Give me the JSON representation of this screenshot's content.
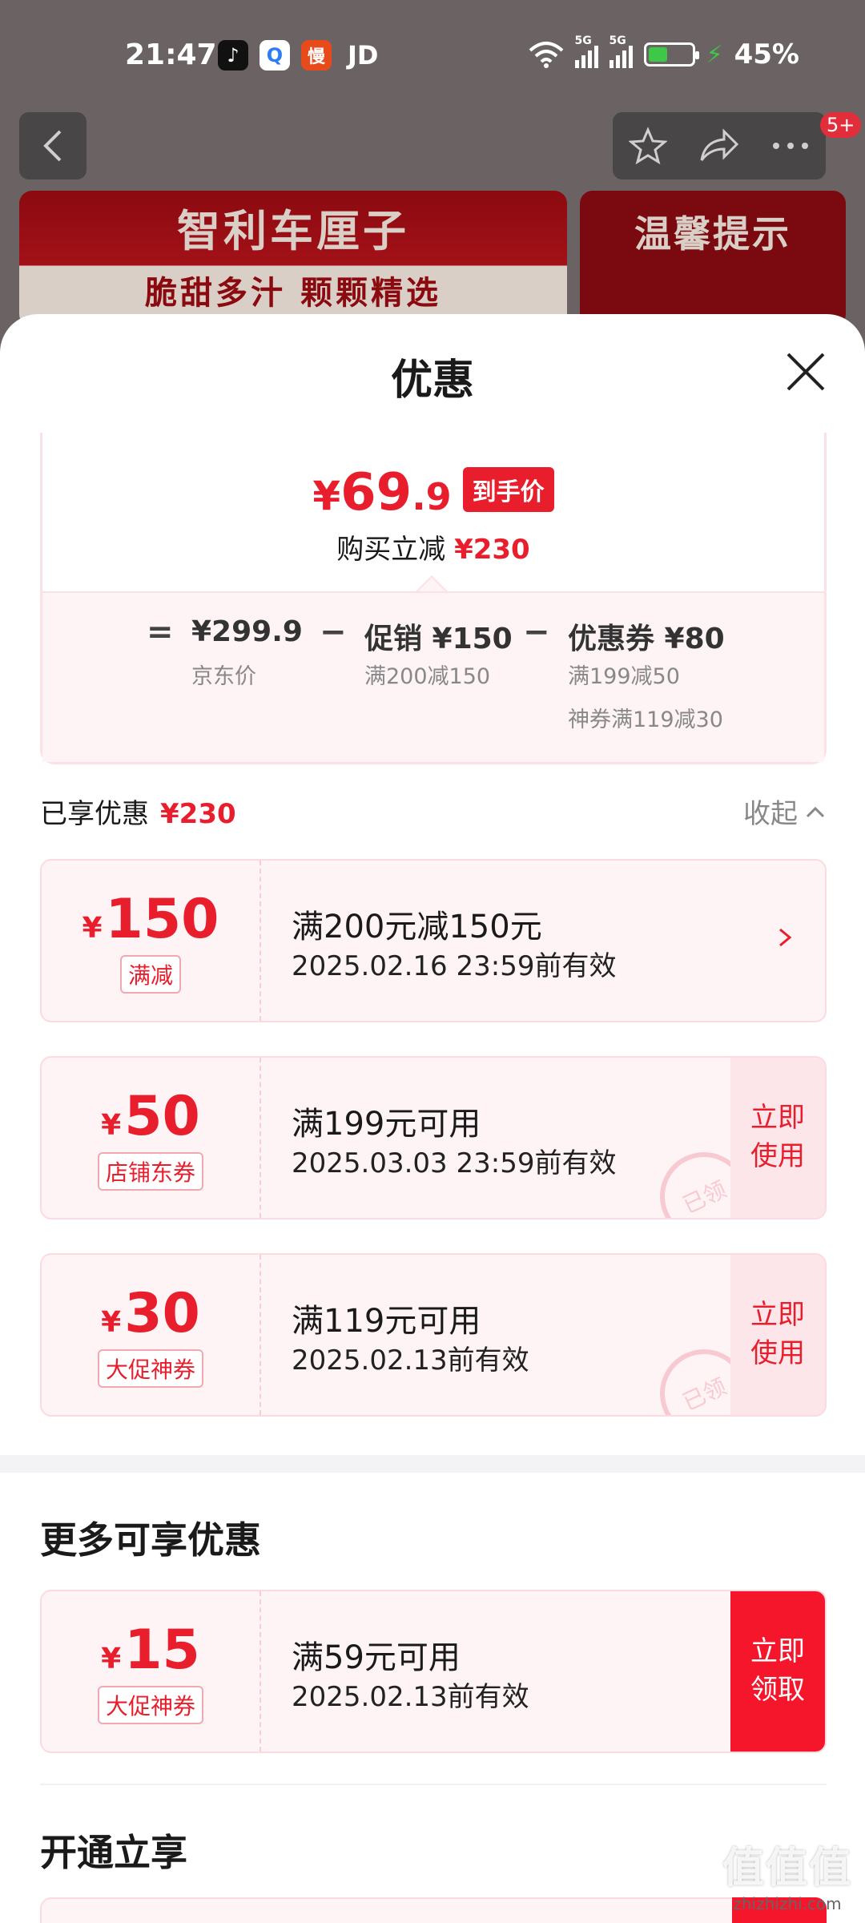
{
  "status_bar": {
    "time": "21:47",
    "app_icons": [
      "tiktok-icon",
      "search-app-icon",
      "manman-app-icon"
    ],
    "carrier": "JD",
    "network_1": "5G",
    "network_2": "5G",
    "battery": "45%",
    "battery_level": 0.45,
    "wifi_icon": "wifi-icon"
  },
  "background_page": {
    "badge": "5+",
    "banner_left_title": "智利车厘子",
    "banner_left_subtitle": "脆甜多汁  颗颗精选",
    "banner_right_title": "温馨提示"
  },
  "sheet": {
    "title": "优惠",
    "summary": {
      "final_price_yen": "¥",
      "final_price_int": "69",
      "final_price_dec": ".9",
      "final_price_tag": "到手价",
      "save_label": "购买立减",
      "save_amount": "¥230",
      "equals": "=",
      "minus": "−",
      "base_price": "¥299.9",
      "base_label": "京东价",
      "promo_value": "促销 ¥150",
      "promo_rule": "满200减150",
      "coupon_value": "优惠券 ¥80",
      "coupon_rule_1": "满199减50",
      "coupon_rule_2": "神券满119减30"
    },
    "enjoyed": {
      "label": "已享优惠",
      "amount": "¥230",
      "collapse": "收起"
    },
    "enjoyed_coupons": [
      {
        "yen": "¥",
        "amount": "150",
        "type": "满减",
        "condition": "满200元减150元",
        "validity": "2025.02.16 23:59前有效"
      },
      {
        "yen": "¥",
        "amount": "50",
        "type": "店铺东券",
        "condition": "满199元可用",
        "validity": "2025.03.03 23:59前有效",
        "action": "立即使用",
        "stamp": "已领"
      },
      {
        "yen": "¥",
        "amount": "30",
        "type": "大促神券",
        "condition": "满119元可用",
        "validity": "2025.02.13前有效",
        "action": "立即使用",
        "stamp": "已领"
      }
    ],
    "more_title": "更多可享优惠",
    "more_coupons": [
      {
        "yen": "¥",
        "amount": "15",
        "type": "大促神券",
        "condition": "满59元可用",
        "validity": "2025.02.13前有效",
        "action": "立即领取"
      }
    ],
    "open_title": "开通立享"
  },
  "watermark": {
    "line1": "值值值",
    "line2": "zhizhizhi.com"
  },
  "colors": {
    "accent": "#e81e2d",
    "coupon_bg": "#fff4f5",
    "claim_bg": "#f5162c"
  }
}
